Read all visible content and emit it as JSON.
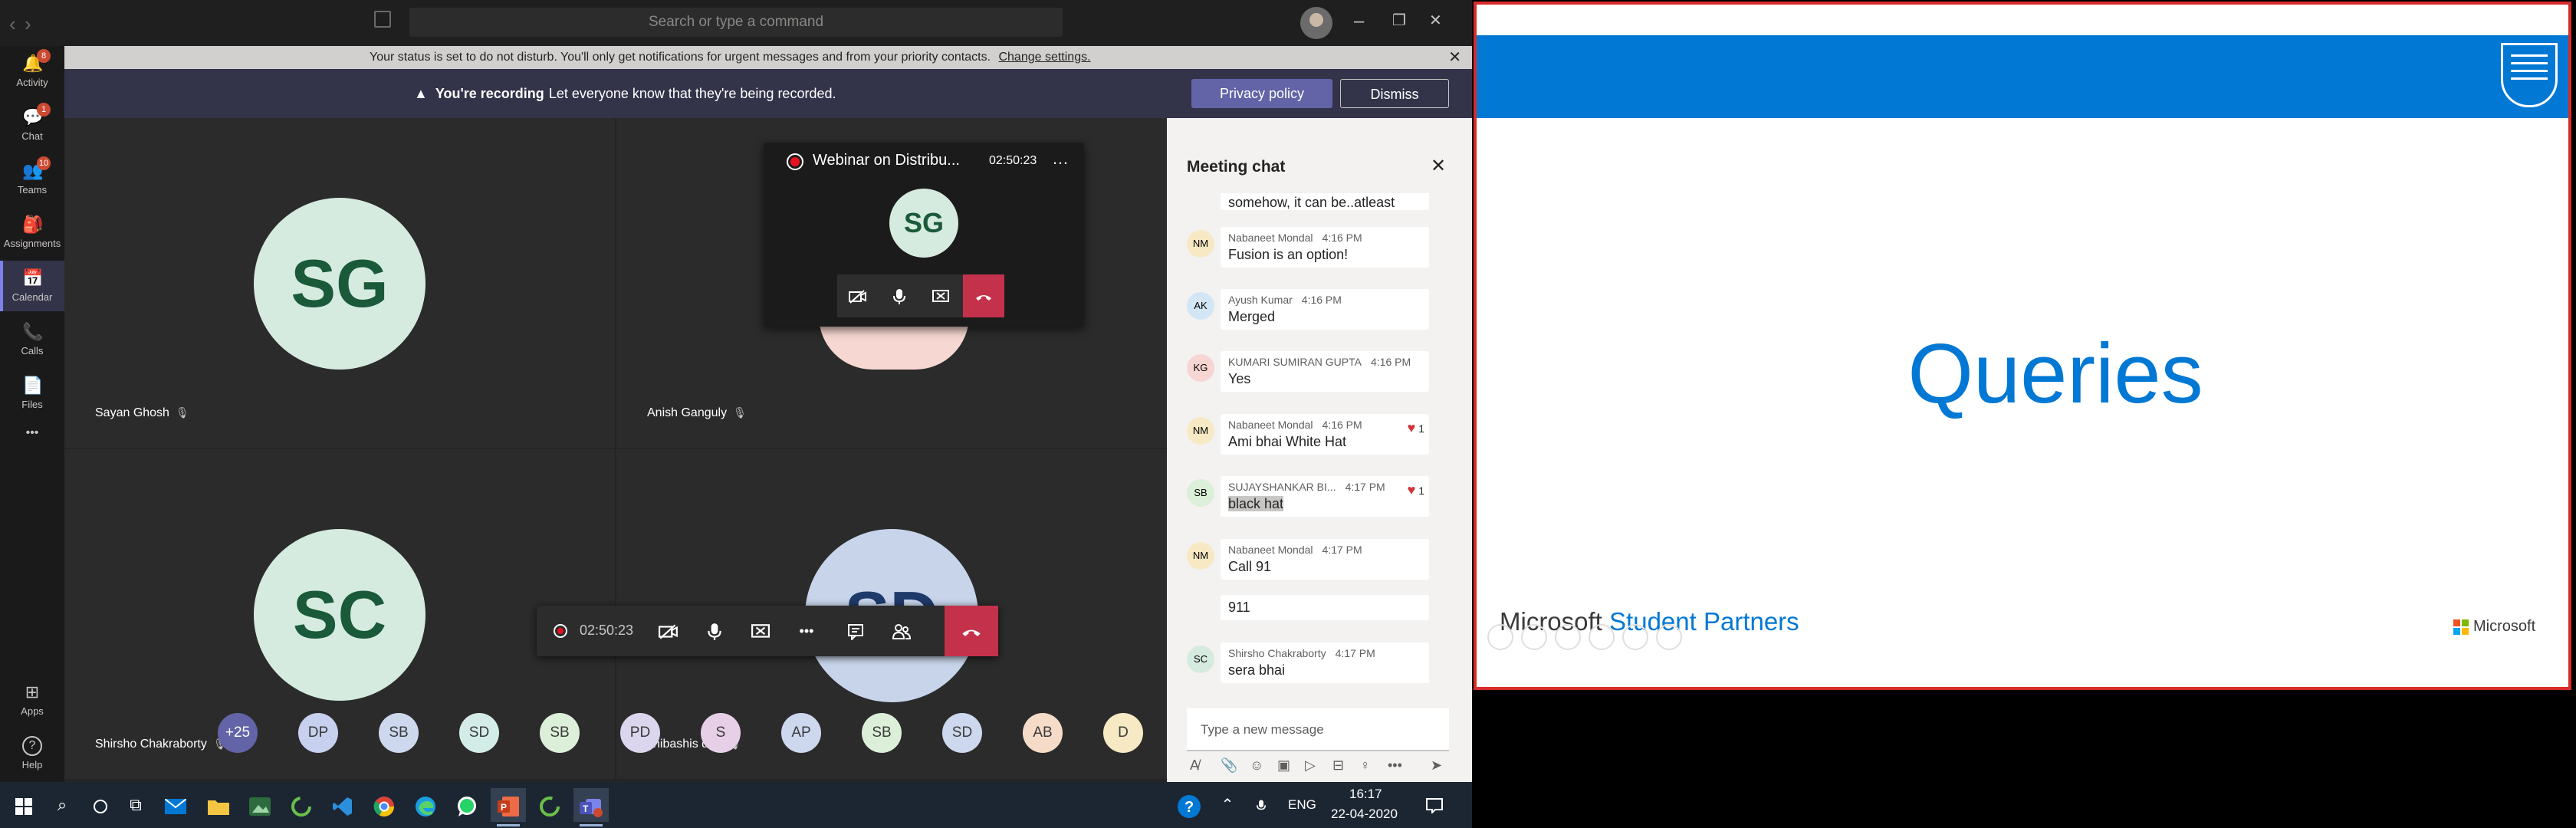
{
  "titlebar": {
    "back": "‹",
    "forward": "›",
    "search_placeholder": "Search or type a command",
    "minimize": "–",
    "maximize": "❐",
    "close": "✕"
  },
  "rail": [
    {
      "label": "Activity",
      "icon": "bell-icon",
      "glyph": "🔔",
      "badge": "8"
    },
    {
      "label": "Chat",
      "icon": "chat-icon",
      "glyph": "💬",
      "badge": "1"
    },
    {
      "label": "Teams",
      "icon": "teams-icon",
      "glyph": "👥",
      "badge": "10"
    },
    {
      "label": "Assignments",
      "icon": "assignments-icon",
      "glyph": "🎒",
      "badge": ""
    },
    {
      "label": "Calendar",
      "icon": "calendar-icon",
      "glyph": "📅",
      "badge": ""
    },
    {
      "label": "Calls",
      "icon": "phone-icon",
      "glyph": "📞",
      "badge": ""
    },
    {
      "label": "Files",
      "icon": "files-icon",
      "glyph": "📄",
      "badge": ""
    }
  ],
  "rail_more": "•••",
  "rail_bottom": [
    {
      "label": "Apps",
      "icon": "apps-icon",
      "glyph": "⊞"
    },
    {
      "label": "Help",
      "icon": "help-icon",
      "glyph": "?"
    }
  ],
  "dnd": {
    "text": "Your status is set to do not disturb. You'll only get notifications for urgent messages and from your priority contacts.",
    "link": "Change settings.",
    "close": "✕"
  },
  "recording": {
    "warn": "▲",
    "bold": "You're recording",
    "text": "Let everyone know that they're being recorded.",
    "privacy_label": "Privacy policy",
    "dismiss_label": "Dismiss"
  },
  "tiles": [
    {
      "initials": "SG",
      "name": "Sayan Ghosh"
    },
    {
      "initials": "",
      "name": "Anish Ganguly"
    },
    {
      "initials": "SC",
      "name": "Shirsho Chakraborty"
    },
    {
      "initials": "SD",
      "name": "shibashis dey"
    }
  ],
  "mic_off_glyph": "🎙",
  "mini_window": {
    "title": "Webinar on Distribu...",
    "time": "02:50:23",
    "more": "…",
    "initials": "SG"
  },
  "call_controls": {
    "time": "02:50:23",
    "more": "•••"
  },
  "participants": [
    {
      "initials": "+25",
      "color": "#6264a7"
    },
    {
      "initials": "DP",
      "color": "#c7d0ee"
    },
    {
      "initials": "SB",
      "color": "#cdd8ee"
    },
    {
      "initials": "SD",
      "color": "#d4ece8"
    },
    {
      "initials": "SB",
      "color": "#dcefd8"
    },
    {
      "initials": "PD",
      "color": "#dcd5ee"
    },
    {
      "initials": "S",
      "color": "#e8cfe8"
    },
    {
      "initials": "AP",
      "color": "#cdd8ee"
    },
    {
      "initials": "SB",
      "color": "#dcefd8"
    },
    {
      "initials": "SD",
      "color": "#cdd8ee"
    },
    {
      "initials": "AB",
      "color": "#f6dcc8"
    },
    {
      "initials": "D",
      "color": "#f6e9c4"
    }
  ],
  "chat": {
    "title": "Meeting chat",
    "close": "✕",
    "messages": [
      {
        "initials": "",
        "name": "",
        "time": "",
        "text": "somehow, it can be..atleast NLP",
        "react": "",
        "avcolor": "#d6ebe0"
      },
      {
        "initials": "NM",
        "name": "Nabaneet Mondal",
        "time": "4:16 PM",
        "text": "Fusion is an option!",
        "react": "",
        "avcolor": "#f6e9c4"
      },
      {
        "initials": "AK",
        "name": "Ayush Kumar",
        "time": "4:16 PM",
        "text": "Merged",
        "react": "",
        "avcolor": "#d3e6f5"
      },
      {
        "initials": "KG",
        "name": "KUMARI SUMIRAN GUPTA",
        "time": "4:16 PM",
        "text": "Yes",
        "react": "",
        "avcolor": "#f6d5d2"
      },
      {
        "initials": "NM",
        "name": "Nabaneet Mondal",
        "time": "4:16 PM",
        "text": "Ami bhai White Hat",
        "react": "1",
        "avcolor": "#f6e9c4"
      },
      {
        "initials": "SB",
        "name": "SUJAYSHANKAR BI...",
        "time": "4:17 PM",
        "text": "black hat",
        "react": "1",
        "avcolor": "#dcefd8"
      },
      {
        "initials": "NM",
        "name": "Nabaneet Mondal",
        "time": "4:17 PM",
        "text": "Call 91",
        "react": "",
        "avcolor": "#f6e9c4"
      },
      {
        "initials": "",
        "name": "",
        "time": "",
        "text": "911",
        "react": "",
        "avcolor": ""
      },
      {
        "initials": "SC",
        "name": "Shirsho Chakraborty",
        "time": "4:17 PM",
        "text": "sera bhai",
        "react": "",
        "avcolor": "#d6ebe0"
      }
    ],
    "compose_placeholder": "Type a new message"
  },
  "taskbar": {
    "lang": "ENG",
    "time": "16:17",
    "date": "22-04-2020",
    "apps": [
      "windows-start",
      "search-icon",
      "cortana-icon",
      "task-view-icon",
      "mail-icon",
      "file-explorer-icon",
      "photos-icon",
      "loading-icon",
      "vscode-icon",
      "chrome-icon",
      "edge-icon",
      "whatsapp-icon",
      "powerpoint-icon",
      "sync-icon",
      "teams-icon"
    ]
  },
  "slide": {
    "title": "Queries",
    "msp_black": "Microsoft",
    "msp_blue": "Student Partners",
    "ms_logo": "Microsoft"
  }
}
